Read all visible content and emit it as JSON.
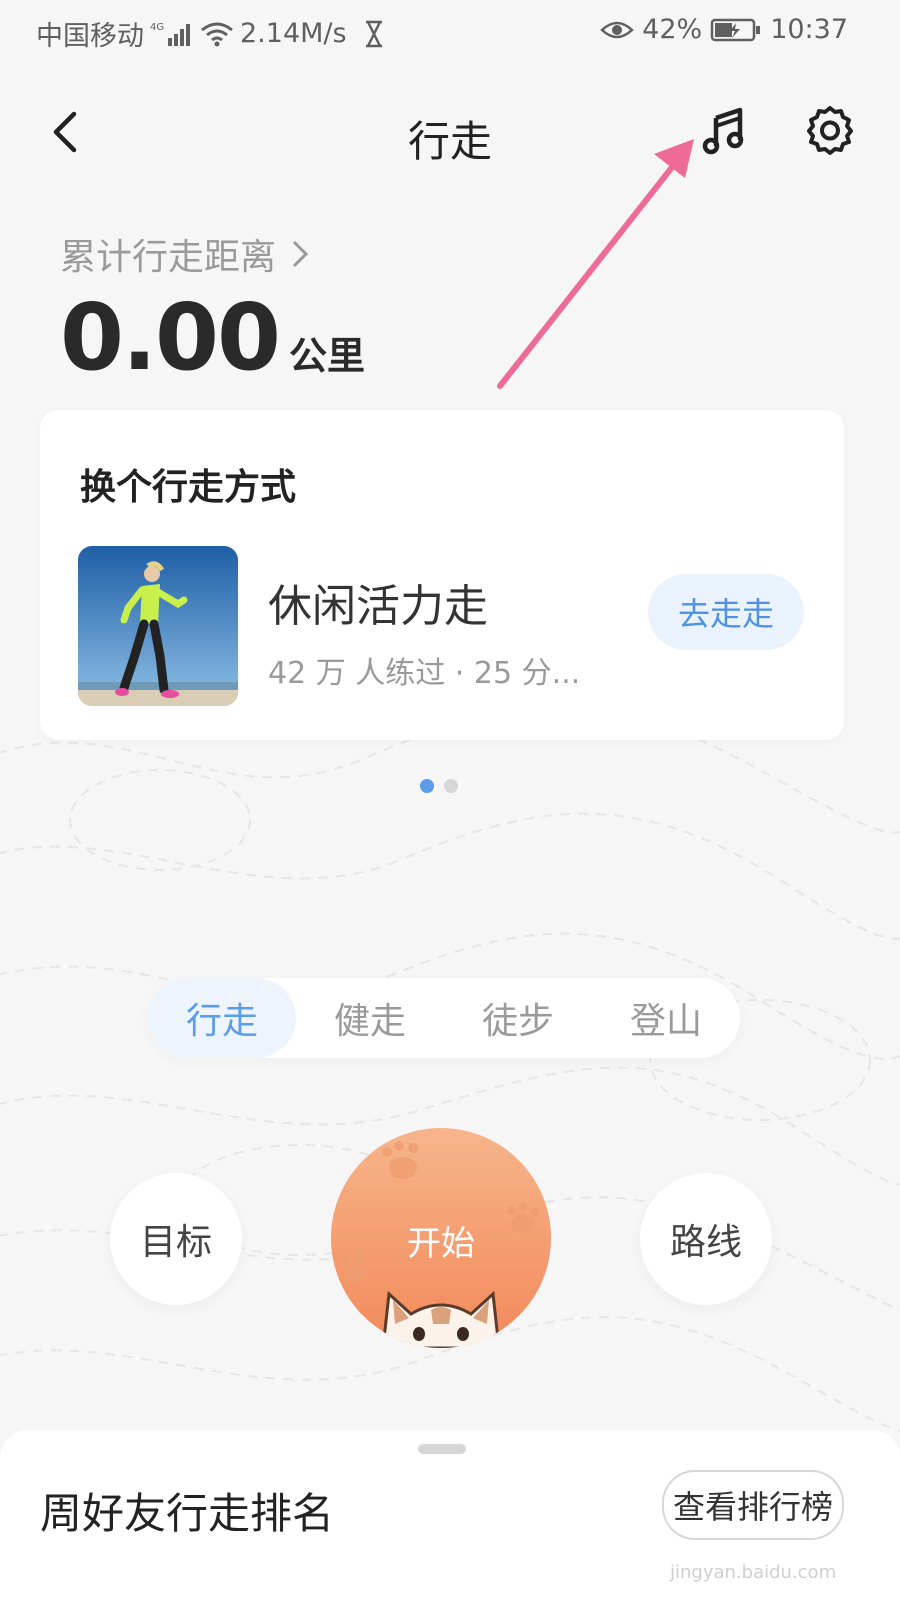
{
  "status_bar": {
    "carrier": "中国移动",
    "network": "4G",
    "speed": "2.14M/s",
    "battery": "42%",
    "time": "10:37",
    "icons": [
      "signal-icon",
      "wifi-icon",
      "hourglass-icon",
      "eye-icon",
      "battery-icon"
    ]
  },
  "nav": {
    "title": "行走",
    "icons": [
      "back-icon",
      "music-note-icon",
      "gear-icon"
    ]
  },
  "distance": {
    "label": "累计行走距离",
    "value": "0.00",
    "unit": "公里"
  },
  "card": {
    "title": "换个行走方式",
    "item": {
      "name": "休闲活力走",
      "meta": "42 万 人练过 · 25 分...",
      "button": "去走走"
    },
    "page_dots": 2,
    "active_dot": 0
  },
  "mode_tabs": {
    "items": [
      "行走",
      "健走",
      "徒步",
      "登山"
    ],
    "active": 0
  },
  "controls": {
    "goal": "目标",
    "start": "开始",
    "route": "路线"
  },
  "bottom_sheet": {
    "title": "周好友行走排名",
    "button": "查看排行榜"
  },
  "watermark": "jingyan.baidu.com",
  "colors": {
    "accent_blue": "#5b9de8",
    "start_orange_top": "#f7b58b",
    "start_orange_bottom": "#f2895a",
    "annotation_pink": "#ee6a97"
  }
}
